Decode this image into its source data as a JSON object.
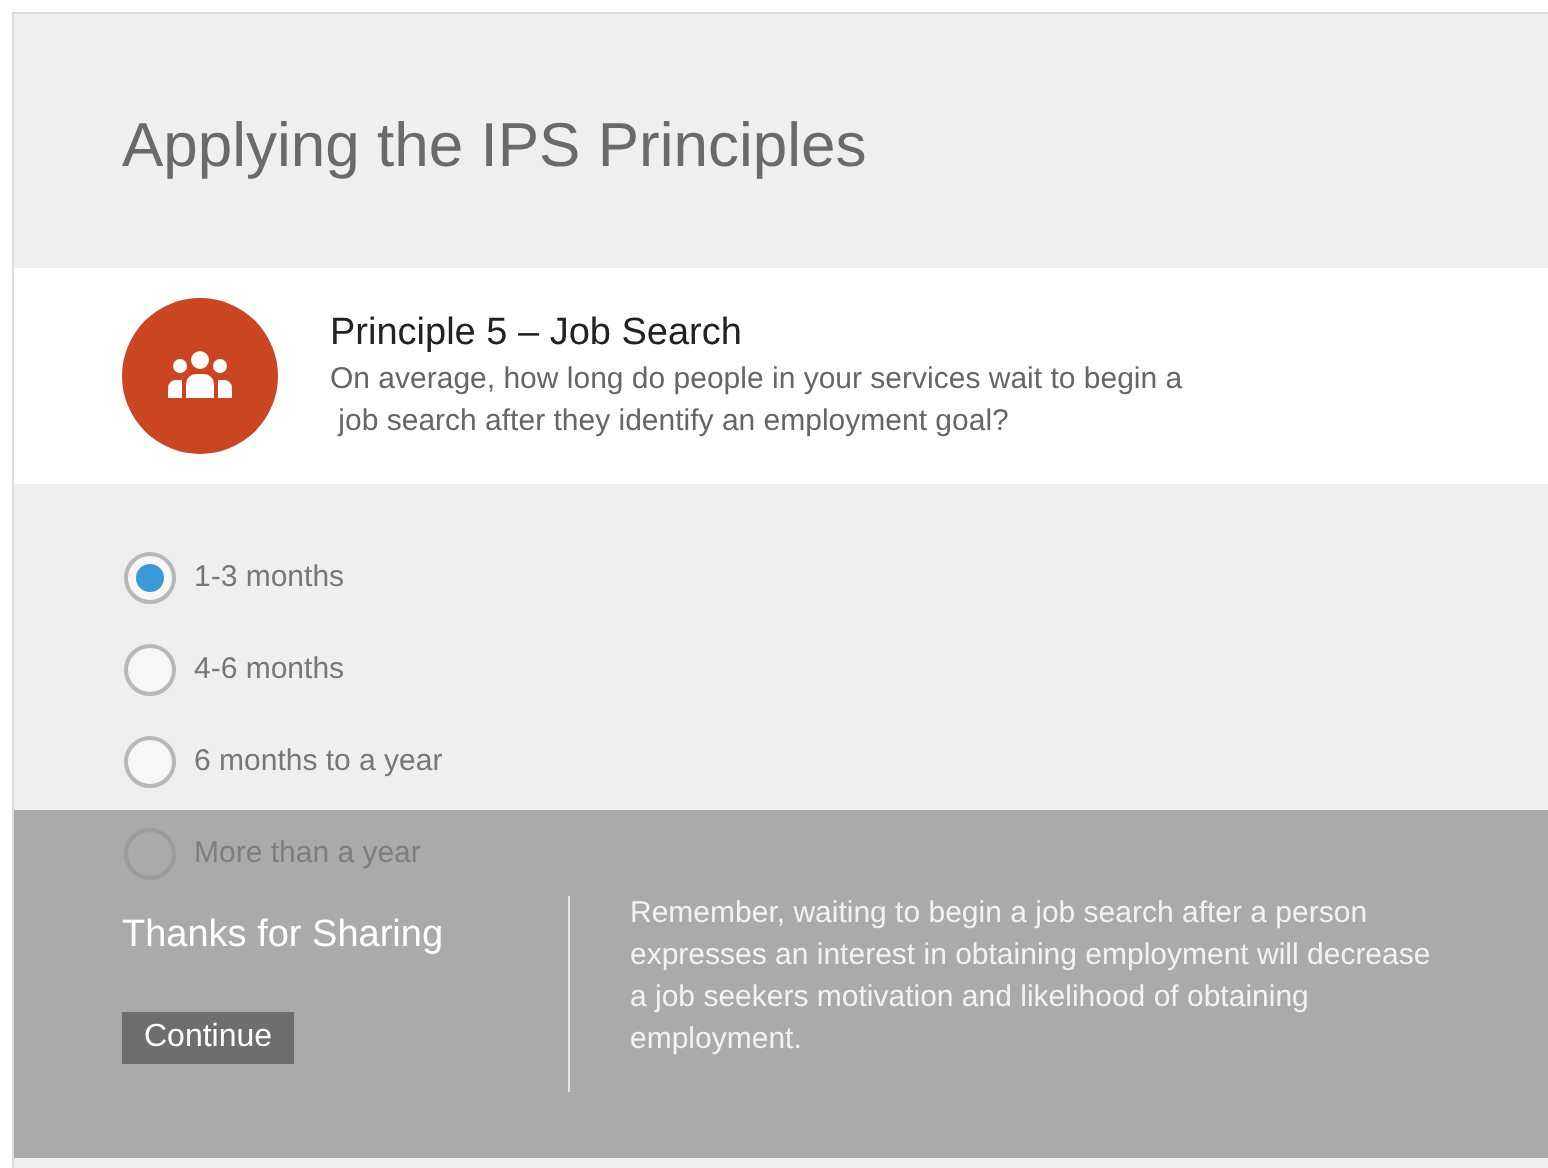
{
  "page": {
    "title": "Applying the IPS Principles"
  },
  "principle": {
    "heading": "Principle 5 – Job Search",
    "question": "On average, how long do people in your services wait to begin a\n job search after they identify an employment goal?"
  },
  "options": [
    {
      "label": "1-3 months",
      "selected": true,
      "covered": false
    },
    {
      "label": "4-6 months",
      "selected": false,
      "covered": false
    },
    {
      "label": "6 months to a year",
      "selected": false,
      "covered": false
    },
    {
      "label": "More than a year",
      "selected": false,
      "covered": true
    }
  ],
  "feedback": {
    "title": "Thanks for Sharing",
    "button": "Continue",
    "message": "Remember, waiting to begin a job search after a person expresses an interest in obtaining employment will decrease a job seekers motivation and likelihood of obtaining employment."
  }
}
